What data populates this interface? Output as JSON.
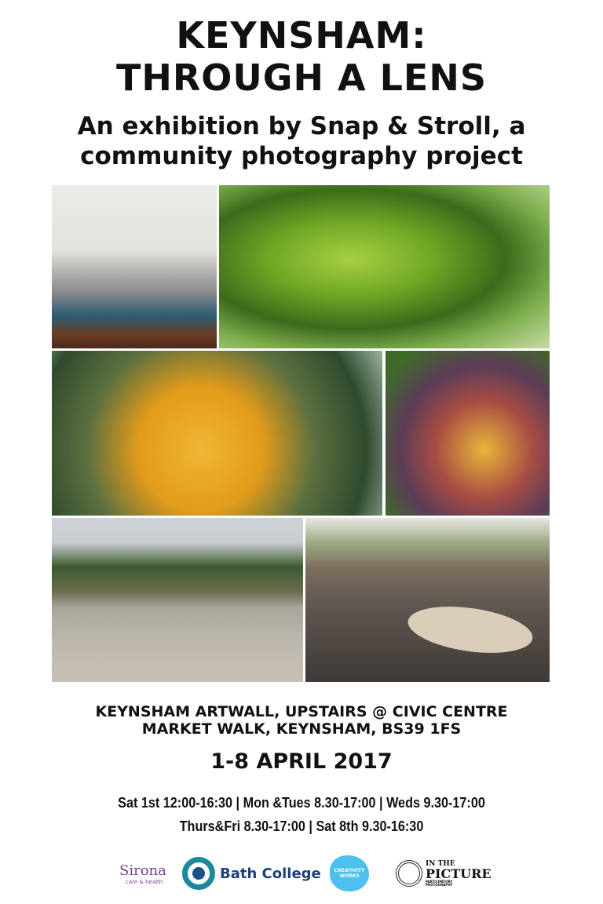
{
  "title_line1": "KEYNSHAM:",
  "title_line2": "THROUGH A LENS",
  "subtitle_line1": "An exhibition by Snap & Stroll, a",
  "subtitle_line2": "community photography project",
  "photos": [
    "open book",
    "moss on branch",
    "orange berries",
    "autumn leaves",
    "skatepark",
    "dry leaf on tarmac"
  ],
  "address_line1": "KEYNSHAM ARTWALL, UPSTAIRS @ CIVIC CENTRE",
  "address_line2": "MARKET WALK, KEYNSHAM, BS39 1FS",
  "dates": "1-8 APRIL 2017",
  "hours_line1": "Sat 1st 12:00-16:30 | Mon &Tues 8.30-17:00 | Weds 9.30-17:00",
  "hours_line2": "Thurs&Fri 8.30-17:00 | Sat 8th 9.30-16:30",
  "logos": {
    "sirona": "Sirona",
    "sirona_tag": "care & health",
    "bath": "Bath College",
    "creativity": "CREATIVITY WORKS",
    "itp1": "IN THE",
    "itp2": "PICTURE",
    "itp3": "PARTICIPATORY PHOTOGRAPHY"
  },
  "colors": {
    "sirona": "#7a3f91",
    "bath": "#1a8a9c",
    "bath_text": "#1d3f7a",
    "creativity": "#4cc0ee"
  }
}
